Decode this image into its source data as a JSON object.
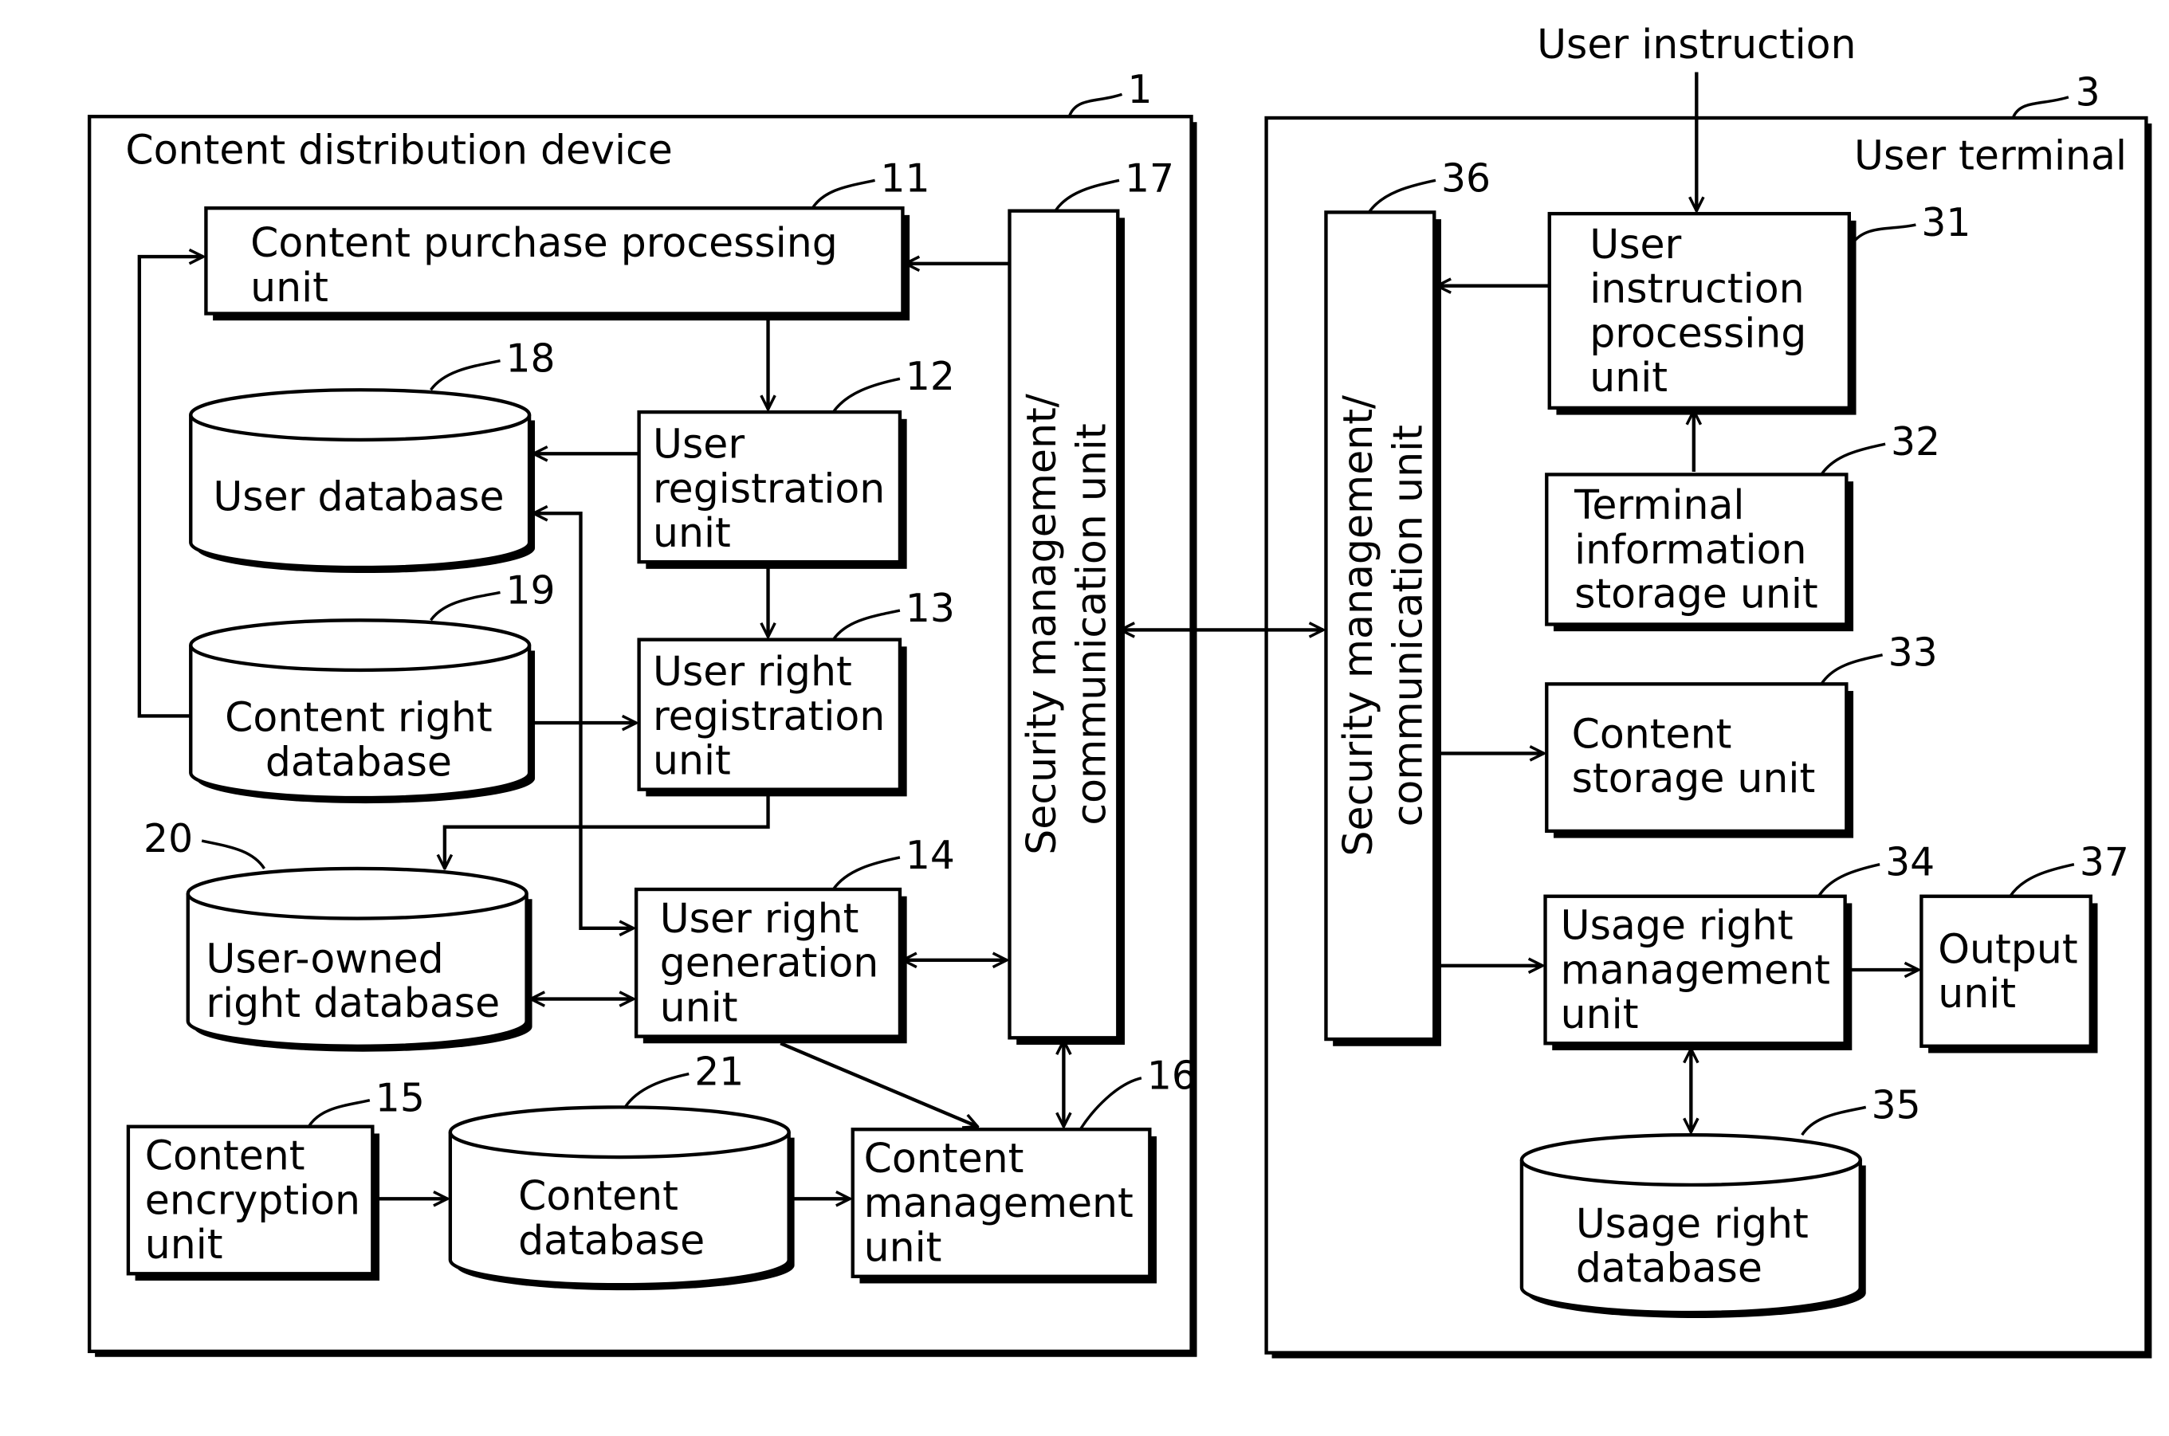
{
  "diagram": {
    "external_input": "User instruction",
    "devices": [
      {
        "id": "device-1",
        "ref": "1",
        "title": "Content distribution device"
      },
      {
        "id": "device-3",
        "ref": "3",
        "title": "User terminal"
      }
    ],
    "units": {
      "u11": {
        "ref": "11",
        "lines": [
          "Content purchase processing",
          "unit"
        ]
      },
      "u12": {
        "ref": "12",
        "lines": [
          "User",
          "registration",
          "unit"
        ]
      },
      "u13": {
        "ref": "13",
        "lines": [
          "User right",
          "registration",
          "unit"
        ]
      },
      "u14": {
        "ref": "14",
        "lines": [
          "User right",
          "generation",
          "unit"
        ]
      },
      "u15": {
        "ref": "15",
        "lines": [
          "Content",
          "encryption",
          "unit"
        ]
      },
      "u16": {
        "ref": "16",
        "lines": [
          "Content",
          "management",
          "unit"
        ]
      },
      "u17": {
        "ref": "17",
        "lines": [
          "Security management/",
          "communication unit"
        ]
      },
      "db18": {
        "ref": "18",
        "lines": [
          "User database"
        ]
      },
      "db19": {
        "ref": "19",
        "lines": [
          "Content right",
          "database"
        ]
      },
      "db20": {
        "ref": "20",
        "lines": [
          "User-owned",
          "right database"
        ]
      },
      "db21": {
        "ref": "21",
        "lines": [
          "Content",
          "database"
        ]
      },
      "u31": {
        "ref": "31",
        "lines": [
          "User",
          "instruction",
          "processing",
          "unit"
        ]
      },
      "u32": {
        "ref": "32",
        "lines": [
          "Terminal",
          "information",
          "storage unit"
        ]
      },
      "u33": {
        "ref": "33",
        "lines": [
          "Content",
          "storage unit"
        ]
      },
      "u34": {
        "ref": "34",
        "lines": [
          "Usage right",
          "management",
          "unit"
        ]
      },
      "db35": {
        "ref": "35",
        "lines": [
          "Usage right",
          "database"
        ]
      },
      "u36": {
        "ref": "36",
        "lines": [
          "Security management/",
          "communication unit"
        ]
      },
      "u37": {
        "ref": "37",
        "lines": [
          "Output",
          "unit"
        ]
      }
    },
    "connections": [
      {
        "from": "u17",
        "to": "u11",
        "type": "arrow"
      },
      {
        "from": "u11",
        "to": "u12",
        "type": "arrow"
      },
      {
        "from": "u12",
        "to": "db18",
        "type": "arrow"
      },
      {
        "from": "u12",
        "to": "u13",
        "type": "arrow"
      },
      {
        "from": "db19",
        "to": "u11",
        "type": "arrow"
      },
      {
        "from": "db19",
        "to": "u13",
        "type": "arrow"
      },
      {
        "from": "u13",
        "to": "db20",
        "type": "arrow"
      },
      {
        "from": "db18",
        "to": "u14",
        "type": "bidirectional"
      },
      {
        "from": "db20",
        "to": "u14",
        "type": "bidirectional"
      },
      {
        "from": "u14",
        "to": "u17",
        "type": "bidirectional"
      },
      {
        "from": "u14",
        "to": "u16",
        "type": "arrow"
      },
      {
        "from": "u15",
        "to": "db21",
        "type": "arrow"
      },
      {
        "from": "db21",
        "to": "u16",
        "type": "arrow"
      },
      {
        "from": "u17",
        "to": "u16",
        "type": "bidirectional"
      },
      {
        "from": "u17",
        "to": "u36",
        "type": "bidirectional"
      },
      {
        "from": "external_input",
        "to": "u31",
        "type": "arrow"
      },
      {
        "from": "u31",
        "to": "u36",
        "type": "arrow"
      },
      {
        "from": "u32",
        "to": "u31",
        "type": "arrow"
      },
      {
        "from": "u36",
        "to": "u33",
        "type": "arrow"
      },
      {
        "from": "u36",
        "to": "u34",
        "type": "arrow"
      },
      {
        "from": "u34",
        "to": "u37",
        "type": "arrow"
      },
      {
        "from": "u34",
        "to": "db35",
        "type": "bidirectional"
      }
    ]
  }
}
